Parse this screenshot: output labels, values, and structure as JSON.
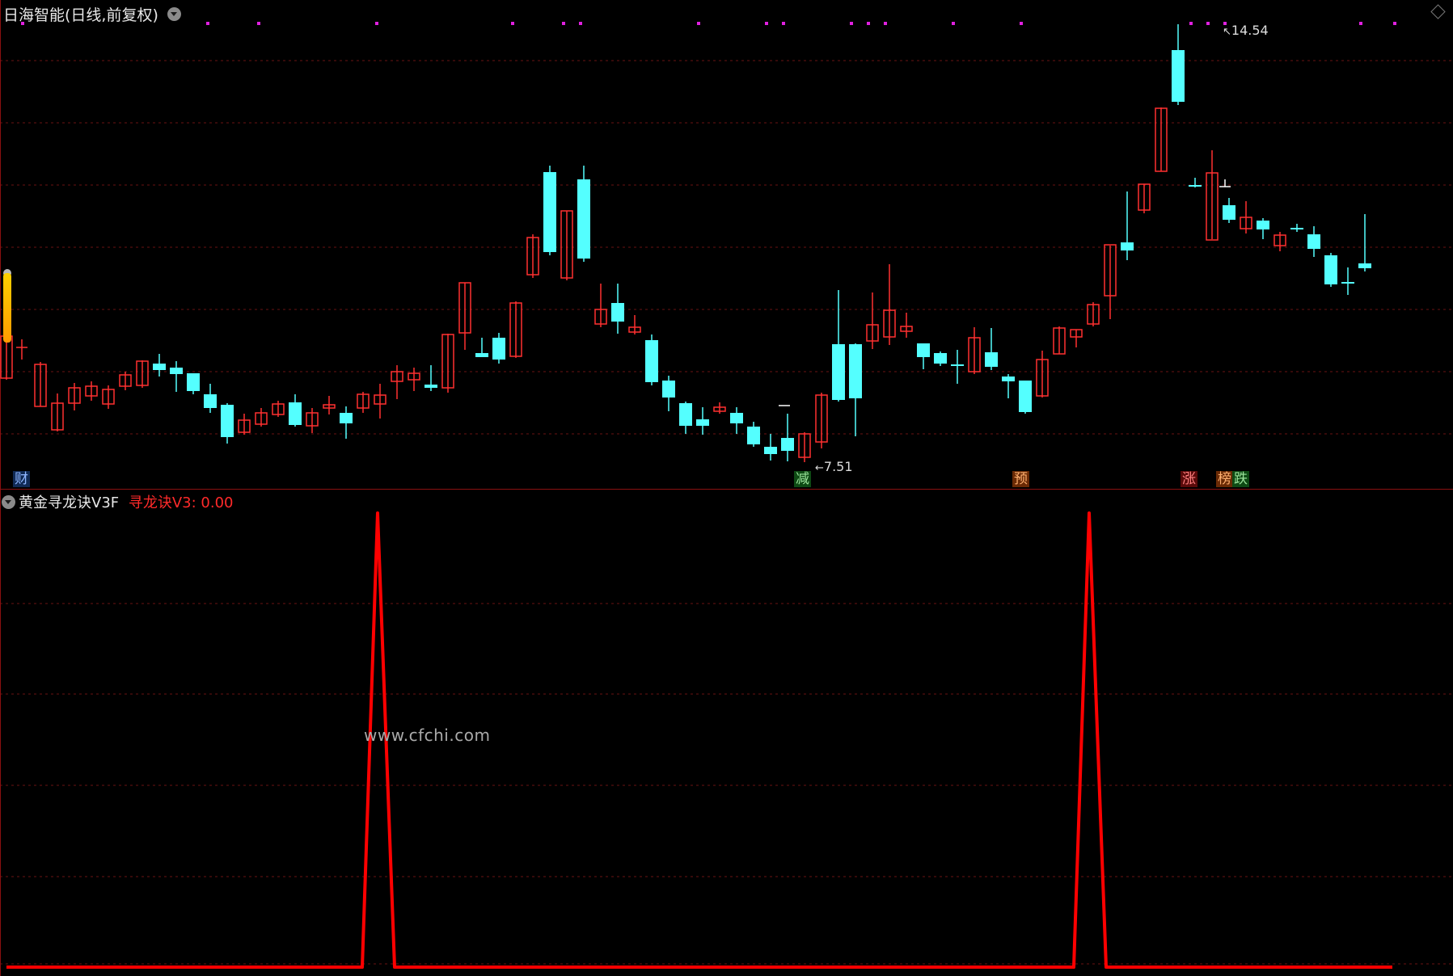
{
  "main_chart": {
    "title": "日海智能(日线,前复权)",
    "high_label": "14.54",
    "low_label": "7.51",
    "signal_tags": [
      {
        "text": "财",
        "color": "#3a6fd8"
      },
      {
        "text": "减",
        "color": "#1e9a2e"
      },
      {
        "text": "预",
        "color": "#d8621a"
      },
      {
        "text": "涨",
        "color": "#d8262a"
      },
      {
        "text": "榜",
        "color": "#d8621a"
      },
      {
        "text": "跌",
        "color": "#1e9a2e"
      }
    ],
    "up_color": "#ff3030",
    "down_color": "#54ffff"
  },
  "indicator": {
    "name": "黄金寻龙诀V3F",
    "value_label": "寻龙诀V3: 0.00",
    "line_color": "#ff0000"
  },
  "watermark": "www.cfchi.com"
}
